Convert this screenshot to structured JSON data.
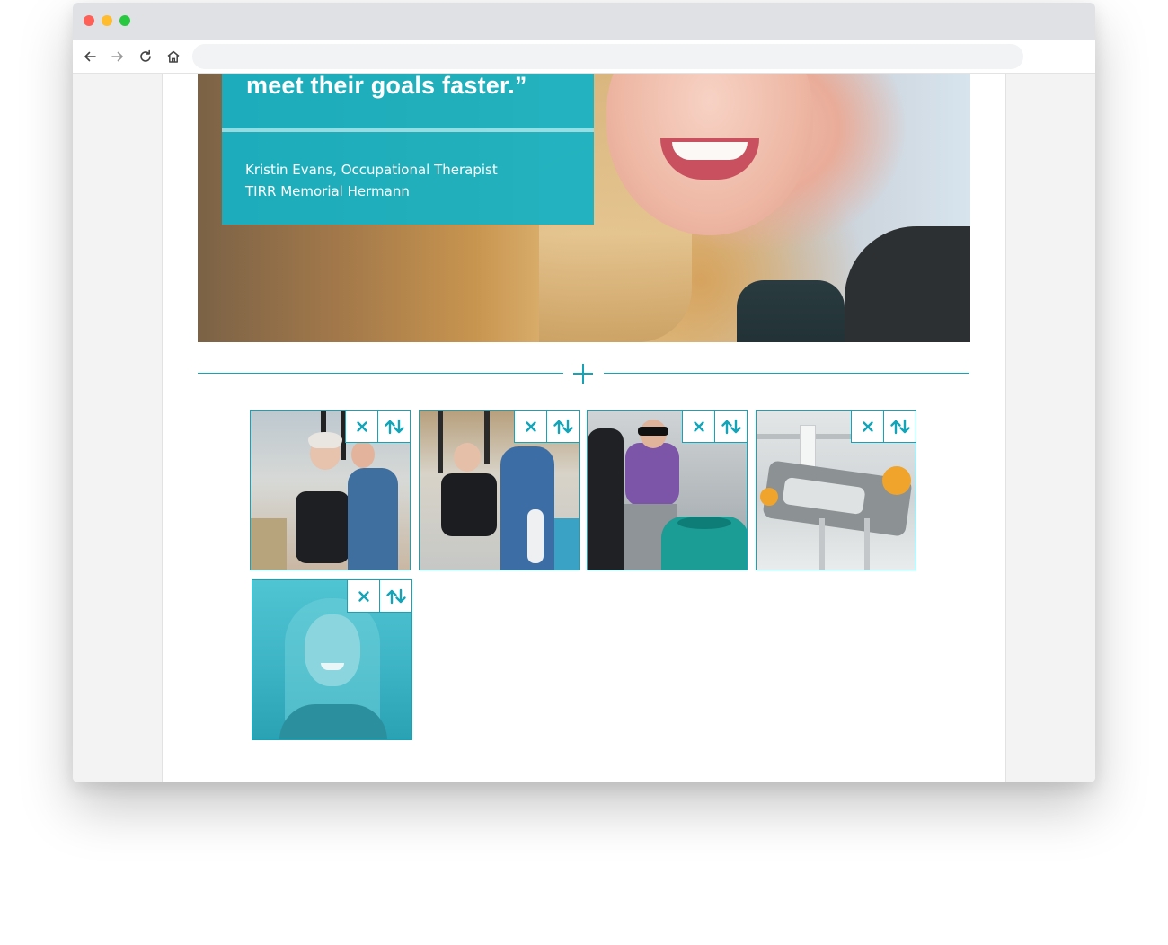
{
  "browser": {
    "address_value": ""
  },
  "hero": {
    "quote": "meet their goals faster.”",
    "attribution_name": "Kristin Evans, Occupational Therapist",
    "attribution_org": "TIRR Memorial Hermann"
  },
  "gallery": {
    "items": [
      {
        "icon": "photo-therapy-harness"
      },
      {
        "icon": "photo-therapy-assisted-walk"
      },
      {
        "icon": "photo-therapy-balance-exercise"
      },
      {
        "icon": "photo-vector-device"
      },
      {
        "icon": "photo-portrait-woman"
      }
    ],
    "remove_icon": "close-icon",
    "reorder_icon": "reorder-icon"
  },
  "colors": {
    "accent": "#14a4b8",
    "quote_box": "#14b2c4"
  }
}
